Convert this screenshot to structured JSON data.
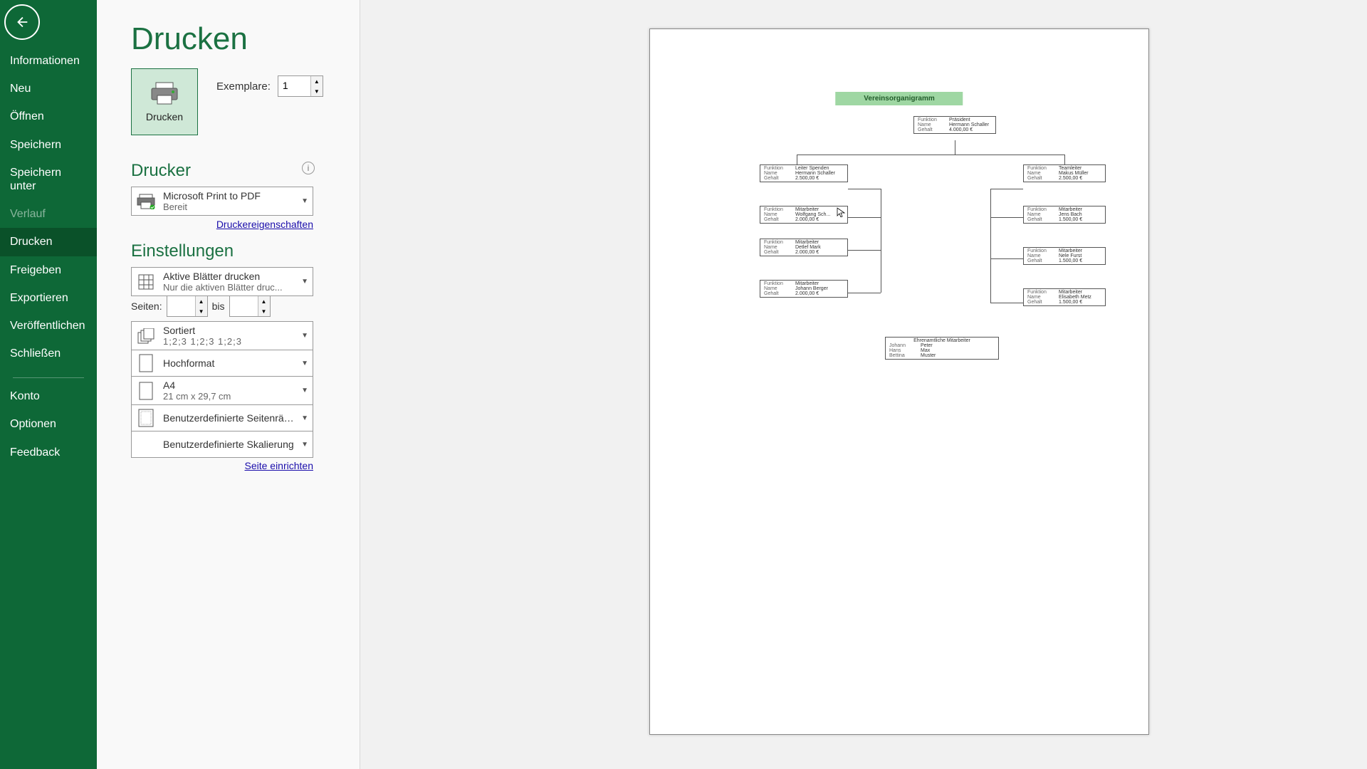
{
  "sidebar": {
    "items": [
      {
        "label": "Informationen"
      },
      {
        "label": "Neu"
      },
      {
        "label": "Öffnen"
      },
      {
        "label": "Speichern"
      },
      {
        "label": "Speichern unter"
      },
      {
        "label": "Verlauf"
      },
      {
        "label": "Drucken"
      },
      {
        "label": "Freigeben"
      },
      {
        "label": "Exportieren"
      },
      {
        "label": "Veröffentlichen"
      },
      {
        "label": "Schließen"
      },
      {
        "label": "Konto"
      },
      {
        "label": "Optionen"
      },
      {
        "label": "Feedback"
      }
    ]
  },
  "panel": {
    "title": "Drucken",
    "print_button": "Drucken",
    "copies_label": "Exemplare:",
    "copies_value": "1",
    "printer_section": "Drucker",
    "printer": {
      "name": "Microsoft Print to PDF",
      "status": "Bereit"
    },
    "printer_props": "Druckereigenschaften",
    "settings_section": "Einstellungen",
    "active_sheets": {
      "l1": "Aktive Blätter drucken",
      "l2": "Nur die aktiven Blätter druc..."
    },
    "pages_label": "Seiten:",
    "pages_to": "bis",
    "pages_from": "",
    "pages_to_val": "",
    "collate": {
      "l1": "Sortiert",
      "l2": "1;2;3    1;2;3    1;2;3"
    },
    "orient": {
      "l1": "Hochformat"
    },
    "paper": {
      "l1": "A4",
      "l2": "21 cm x 29,7 cm"
    },
    "margins": {
      "l1": "Benutzerdefinierte Seitenrän..."
    },
    "scaling": {
      "l1": "Benutzerdefinierte Skalierung"
    },
    "page_setup": "Seite einrichten"
  },
  "preview": {
    "title": "Vereinsorganigramm",
    "fields": {
      "f": "Funktion",
      "n": "Name",
      "g": "Gehalt"
    },
    "top": {
      "func": "Präsident",
      "name": "Hermann Schaller",
      "sal": "4.000,00 €"
    },
    "left": [
      {
        "func": "Leiter Spenden",
        "name": "Hermann Schaller",
        "sal": "2.500,00 €"
      },
      {
        "func": "Mitarbeiter",
        "name": "Wolfgang Sch...",
        "sal": "2.000,00 €"
      },
      {
        "func": "Mitarbeiter",
        "name": "Detlef Mark",
        "sal": "2.000,00 €"
      },
      {
        "func": "Mitarbeiter",
        "name": "Johann Berger",
        "sal": "2.000,00 €"
      }
    ],
    "right": [
      {
        "func": "Teamleiter",
        "name": "Makus Müller",
        "sal": "2.500,00 €"
      },
      {
        "func": "Mitarbeiter",
        "name": "Jens Bach",
        "sal": "1.500,00 €"
      },
      {
        "func": "Mitarbeiter",
        "name": "Nele Furst",
        "sal": "1.500,00 €"
      },
      {
        "func": "Mitarbeiter",
        "name": "Elisabeth Metz",
        "sal": "1.500,00 €"
      }
    ],
    "volunteers": {
      "title": "Ehrenamtliche Mitarbeiter",
      "rows": [
        [
          "Johann",
          "Peter"
        ],
        [
          "Hans",
          "Max"
        ],
        [
          "Bettina",
          "Muster"
        ]
      ]
    }
  }
}
